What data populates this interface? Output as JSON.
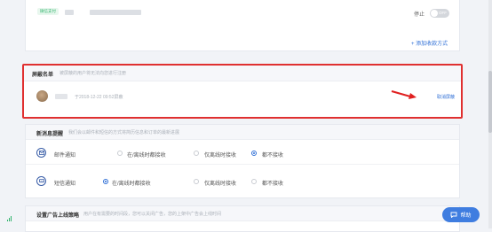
{
  "payment": {
    "badge": "微信支付",
    "status_label": "停止",
    "toggle_label": "OFF",
    "add_label": "+ 添加收款方式"
  },
  "blocklist": {
    "title": "屏蔽名单",
    "desc": "被屏蔽的用户将无法向您进行注册",
    "entry_time": "于2018-12-22 09:52屏蔽",
    "unblock_label": "取消屏蔽"
  },
  "notify": {
    "title": "新消息提醒",
    "desc": "我们会以邮件和短信的方式将简历信息和订单的最新进展",
    "rows": [
      {
        "label": "邮件通知",
        "options": [
          "在/离线时都接收",
          "仅离线时接收",
          "都不接收"
        ],
        "selected": 2
      },
      {
        "label": "短信通知",
        "options": [
          "在/离线时都接收",
          "仅离线时接收",
          "都不接收"
        ],
        "selected": 0
      }
    ]
  },
  "ads": {
    "title": "设置广告上线策略",
    "desc": "用户在有需要的时间段，您可以关闭广告，您的上架中广告会上线时间"
  },
  "help": {
    "label": "帮助"
  }
}
